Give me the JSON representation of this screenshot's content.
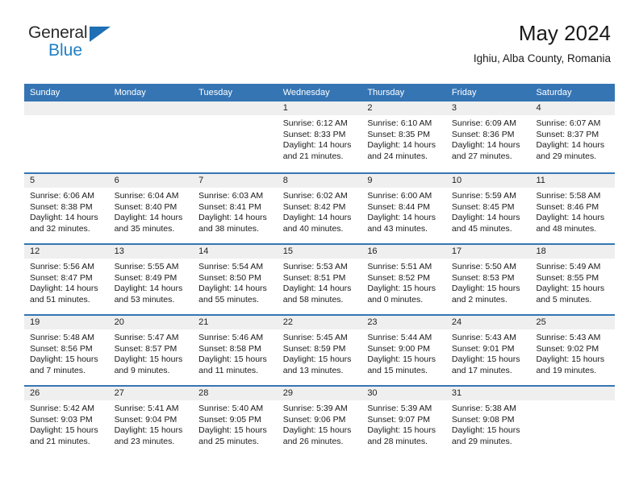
{
  "brand": {
    "name_top": "General",
    "name_bottom": "Blue",
    "color_top": "#2b2b2b",
    "color_bottom": "#1f7fc4",
    "triangle_color": "#1f6fb5"
  },
  "header": {
    "title": "May 2024",
    "subtitle": "Ighiu, Alba County, Romania"
  },
  "theme": {
    "header_blue": "#3575b4",
    "day_band_gray": "#efefef",
    "text": "#1a1a1a"
  },
  "calendar": {
    "day_headers": [
      "Sunday",
      "Monday",
      "Tuesday",
      "Wednesday",
      "Thursday",
      "Friday",
      "Saturday"
    ],
    "weeks": [
      [
        {
          "day": "",
          "empty": true
        },
        {
          "day": "",
          "empty": true
        },
        {
          "day": "",
          "empty": true
        },
        {
          "day": "1",
          "sunrise": "Sunrise: 6:12 AM",
          "sunset": "Sunset: 8:33 PM",
          "daylight": "Daylight: 14 hours and 21 minutes."
        },
        {
          "day": "2",
          "sunrise": "Sunrise: 6:10 AM",
          "sunset": "Sunset: 8:35 PM",
          "daylight": "Daylight: 14 hours and 24 minutes."
        },
        {
          "day": "3",
          "sunrise": "Sunrise: 6:09 AM",
          "sunset": "Sunset: 8:36 PM",
          "daylight": "Daylight: 14 hours and 27 minutes."
        },
        {
          "day": "4",
          "sunrise": "Sunrise: 6:07 AM",
          "sunset": "Sunset: 8:37 PM",
          "daylight": "Daylight: 14 hours and 29 minutes."
        }
      ],
      [
        {
          "day": "5",
          "sunrise": "Sunrise: 6:06 AM",
          "sunset": "Sunset: 8:38 PM",
          "daylight": "Daylight: 14 hours and 32 minutes."
        },
        {
          "day": "6",
          "sunrise": "Sunrise: 6:04 AM",
          "sunset": "Sunset: 8:40 PM",
          "daylight": "Daylight: 14 hours and 35 minutes."
        },
        {
          "day": "7",
          "sunrise": "Sunrise: 6:03 AM",
          "sunset": "Sunset: 8:41 PM",
          "daylight": "Daylight: 14 hours and 38 minutes."
        },
        {
          "day": "8",
          "sunrise": "Sunrise: 6:02 AM",
          "sunset": "Sunset: 8:42 PM",
          "daylight": "Daylight: 14 hours and 40 minutes."
        },
        {
          "day": "9",
          "sunrise": "Sunrise: 6:00 AM",
          "sunset": "Sunset: 8:44 PM",
          "daylight": "Daylight: 14 hours and 43 minutes."
        },
        {
          "day": "10",
          "sunrise": "Sunrise: 5:59 AM",
          "sunset": "Sunset: 8:45 PM",
          "daylight": "Daylight: 14 hours and 45 minutes."
        },
        {
          "day": "11",
          "sunrise": "Sunrise: 5:58 AM",
          "sunset": "Sunset: 8:46 PM",
          "daylight": "Daylight: 14 hours and 48 minutes."
        }
      ],
      [
        {
          "day": "12",
          "sunrise": "Sunrise: 5:56 AM",
          "sunset": "Sunset: 8:47 PM",
          "daylight": "Daylight: 14 hours and 51 minutes."
        },
        {
          "day": "13",
          "sunrise": "Sunrise: 5:55 AM",
          "sunset": "Sunset: 8:49 PM",
          "daylight": "Daylight: 14 hours and 53 minutes."
        },
        {
          "day": "14",
          "sunrise": "Sunrise: 5:54 AM",
          "sunset": "Sunset: 8:50 PM",
          "daylight": "Daylight: 14 hours and 55 minutes."
        },
        {
          "day": "15",
          "sunrise": "Sunrise: 5:53 AM",
          "sunset": "Sunset: 8:51 PM",
          "daylight": "Daylight: 14 hours and 58 minutes."
        },
        {
          "day": "16",
          "sunrise": "Sunrise: 5:51 AM",
          "sunset": "Sunset: 8:52 PM",
          "daylight": "Daylight: 15 hours and 0 minutes."
        },
        {
          "day": "17",
          "sunrise": "Sunrise: 5:50 AM",
          "sunset": "Sunset: 8:53 PM",
          "daylight": "Daylight: 15 hours and 2 minutes."
        },
        {
          "day": "18",
          "sunrise": "Sunrise: 5:49 AM",
          "sunset": "Sunset: 8:55 PM",
          "daylight": "Daylight: 15 hours and 5 minutes."
        }
      ],
      [
        {
          "day": "19",
          "sunrise": "Sunrise: 5:48 AM",
          "sunset": "Sunset: 8:56 PM",
          "daylight": "Daylight: 15 hours and 7 minutes."
        },
        {
          "day": "20",
          "sunrise": "Sunrise: 5:47 AM",
          "sunset": "Sunset: 8:57 PM",
          "daylight": "Daylight: 15 hours and 9 minutes."
        },
        {
          "day": "21",
          "sunrise": "Sunrise: 5:46 AM",
          "sunset": "Sunset: 8:58 PM",
          "daylight": "Daylight: 15 hours and 11 minutes."
        },
        {
          "day": "22",
          "sunrise": "Sunrise: 5:45 AM",
          "sunset": "Sunset: 8:59 PM",
          "daylight": "Daylight: 15 hours and 13 minutes."
        },
        {
          "day": "23",
          "sunrise": "Sunrise: 5:44 AM",
          "sunset": "Sunset: 9:00 PM",
          "daylight": "Daylight: 15 hours and 15 minutes."
        },
        {
          "day": "24",
          "sunrise": "Sunrise: 5:43 AM",
          "sunset": "Sunset: 9:01 PM",
          "daylight": "Daylight: 15 hours and 17 minutes."
        },
        {
          "day": "25",
          "sunrise": "Sunrise: 5:43 AM",
          "sunset": "Sunset: 9:02 PM",
          "daylight": "Daylight: 15 hours and 19 minutes."
        }
      ],
      [
        {
          "day": "26",
          "sunrise": "Sunrise: 5:42 AM",
          "sunset": "Sunset: 9:03 PM",
          "daylight": "Daylight: 15 hours and 21 minutes."
        },
        {
          "day": "27",
          "sunrise": "Sunrise: 5:41 AM",
          "sunset": "Sunset: 9:04 PM",
          "daylight": "Daylight: 15 hours and 23 minutes."
        },
        {
          "day": "28",
          "sunrise": "Sunrise: 5:40 AM",
          "sunset": "Sunset: 9:05 PM",
          "daylight": "Daylight: 15 hours and 25 minutes."
        },
        {
          "day": "29",
          "sunrise": "Sunrise: 5:39 AM",
          "sunset": "Sunset: 9:06 PM",
          "daylight": "Daylight: 15 hours and 26 minutes."
        },
        {
          "day": "30",
          "sunrise": "Sunrise: 5:39 AM",
          "sunset": "Sunset: 9:07 PM",
          "daylight": "Daylight: 15 hours and 28 minutes."
        },
        {
          "day": "31",
          "sunrise": "Sunrise: 5:38 AM",
          "sunset": "Sunset: 9:08 PM",
          "daylight": "Daylight: 15 hours and 29 minutes."
        },
        {
          "day": "",
          "empty": true
        }
      ]
    ]
  }
}
